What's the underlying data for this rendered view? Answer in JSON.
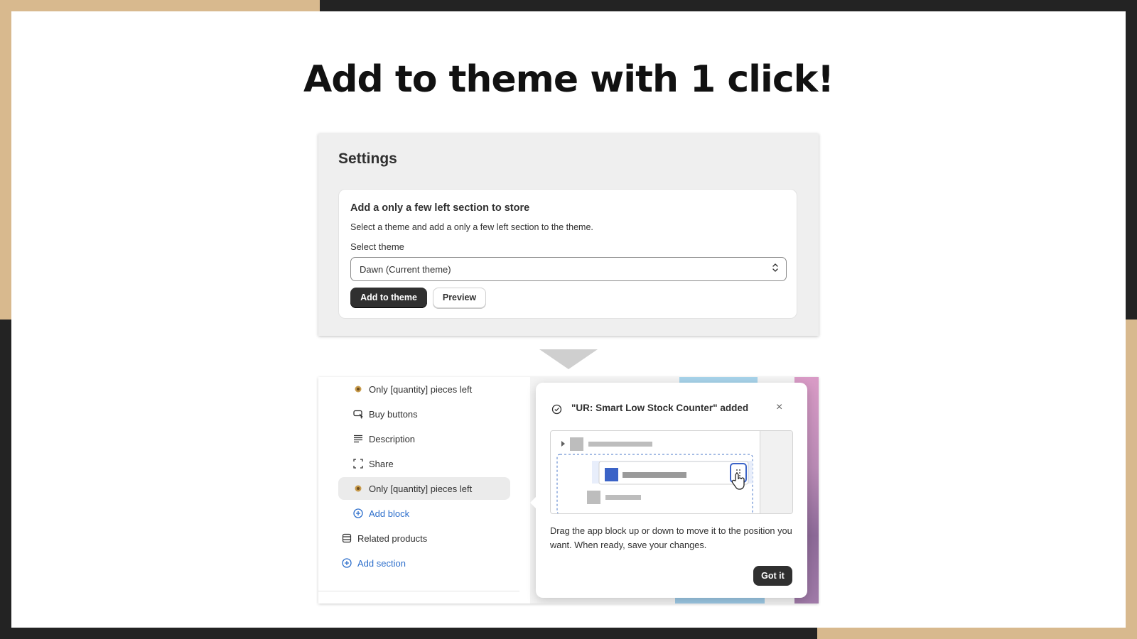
{
  "headline": "Add to theme with 1 click!",
  "settings": {
    "title": "Settings",
    "card_title": "Add a only a few left section to store",
    "card_description": "Select a theme and add a only a few left section to the theme.",
    "select_label": "Select theme",
    "select_value": "Dawn (Current theme)",
    "add_button": "Add to theme",
    "preview_button": "Preview"
  },
  "editor": {
    "tree": [
      {
        "label": "Only [quantity] pieces left",
        "icon": "app-block-icon"
      },
      {
        "label": "Buy buttons",
        "icon": "buy-buttons-icon"
      },
      {
        "label": "Description",
        "icon": "text-lines-icon"
      },
      {
        "label": "Share",
        "icon": "share-icon"
      },
      {
        "label": "Only [quantity] pieces left",
        "icon": "app-block-icon"
      },
      {
        "label": "Add block",
        "icon": "plus-circle-icon"
      },
      {
        "label": "Related products",
        "icon": "section-icon"
      },
      {
        "label": "Add section",
        "icon": "plus-circle-icon"
      }
    ],
    "popover": {
      "title": "\"UR: Smart Low Stock Counter\" added",
      "body": "Drag the app block up or down to move it to the position you want. When ready, save your changes.",
      "confirm_button": "Got it",
      "close_symbol": "×"
    }
  },
  "colors": {
    "tan": "#d8b98e",
    "dark": "#232323",
    "primary_button": "#303030",
    "link": "#2c6ecb"
  }
}
